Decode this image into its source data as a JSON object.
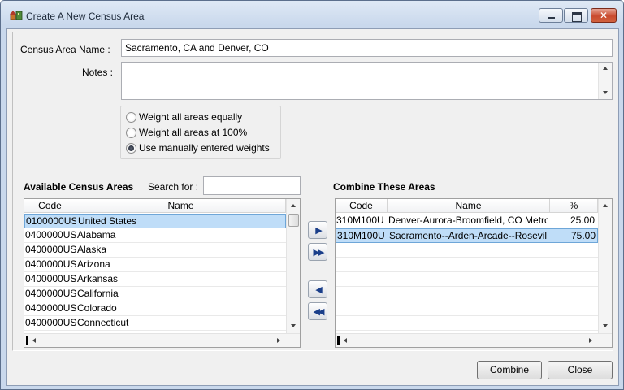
{
  "window": {
    "title": "Create A New Census Area"
  },
  "form": {
    "census_area_name_label": "Census Area Name :",
    "census_area_name_value": "Sacramento, CA and Denver, CO",
    "notes_label": "Notes :",
    "notes_value": ""
  },
  "weighting": {
    "options": [
      {
        "label": "Weight all areas equally",
        "checked": false
      },
      {
        "label": "Weight all areas at 100%",
        "checked": false
      },
      {
        "label": "Use manually entered weights",
        "checked": true
      }
    ]
  },
  "available": {
    "title": "Available Census Areas",
    "search_label": "Search for :",
    "search_value": "",
    "columns": [
      "Code",
      "Name"
    ],
    "rows": [
      {
        "code": "0100000US",
        "name": "United States",
        "selected": true
      },
      {
        "code": "0400000US",
        "name": "Alabama"
      },
      {
        "code": "0400000US",
        "name": "Alaska"
      },
      {
        "code": "0400000US",
        "name": "Arizona"
      },
      {
        "code": "0400000US",
        "name": "Arkansas"
      },
      {
        "code": "0400000US",
        "name": "California"
      },
      {
        "code": "0400000US",
        "name": "Colorado"
      },
      {
        "code": "0400000US",
        "name": "Connecticut"
      }
    ]
  },
  "combine": {
    "title": "Combine These Areas",
    "columns": [
      "Code",
      "Name",
      "%"
    ],
    "rows": [
      {
        "code": "310M100U",
        "name": "Denver-Aurora-Broomfield, CO Metro",
        "pct": "25.00"
      },
      {
        "code": "310M100U",
        "name": "Sacramento--Arden-Arcade--Rosevil",
        "pct": "75.00",
        "selected": true
      }
    ]
  },
  "movers": {
    "add": "▶",
    "add_all": "▶▶",
    "remove": "◀",
    "remove_all": "◀◀"
  },
  "buttons": {
    "combine": "Combine",
    "close": "Close"
  },
  "colors": {
    "selection": "#bfddf8",
    "accent_icon": "#1b3f8a"
  }
}
